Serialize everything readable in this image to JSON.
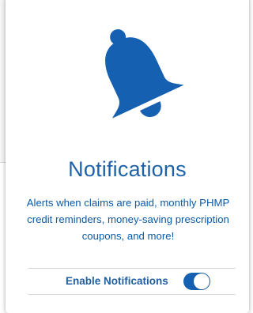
{
  "notifications": {
    "title": "Notifications",
    "description": "Alerts when claims are paid, monthly PHMP credit reminders, money-saving prescription coupons, and more!",
    "toggle_label": "Enable Notifications",
    "toggle_state": "on"
  },
  "icons": {
    "bell": "bell-icon"
  },
  "colors": {
    "accent": "#1560b0",
    "title": "#1f62a8",
    "text": "#0b5aa8"
  }
}
